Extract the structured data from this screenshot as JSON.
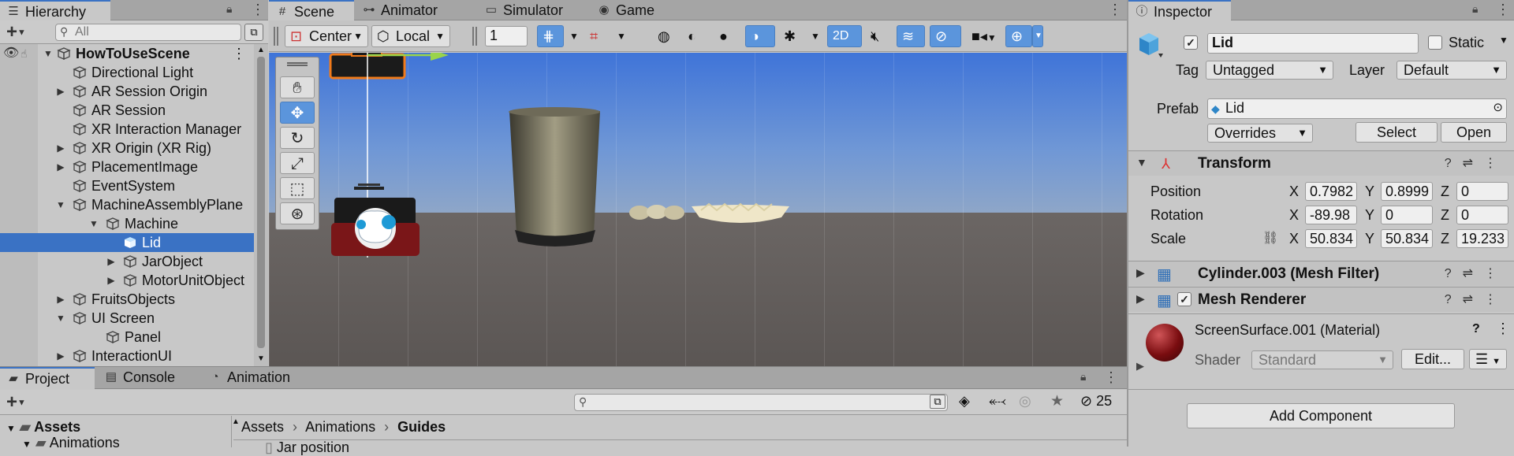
{
  "hierarchy": {
    "tab_label": "Hierarchy",
    "search_placeholder": "All",
    "add_label": "+",
    "items": [
      {
        "label": "HowToUseScene",
        "depth": 0,
        "expand": "down",
        "bold": true,
        "selected": false
      },
      {
        "label": "Directional Light",
        "depth": 1,
        "expand": "",
        "bold": false,
        "selected": false
      },
      {
        "label": "AR Session Origin",
        "depth": 1,
        "expand": "right",
        "bold": false,
        "selected": false
      },
      {
        "label": "AR Session",
        "depth": 1,
        "expand": "",
        "bold": false,
        "selected": false
      },
      {
        "label": "XR Interaction Manager",
        "depth": 1,
        "expand": "",
        "bold": false,
        "selected": false
      },
      {
        "label": "XR Origin (XR Rig)",
        "depth": 1,
        "expand": "right",
        "bold": false,
        "selected": false
      },
      {
        "label": "PlacementImage",
        "depth": 1,
        "expand": "right",
        "bold": false,
        "selected": false
      },
      {
        "label": "EventSystem",
        "depth": 1,
        "expand": "",
        "bold": false,
        "selected": false
      },
      {
        "label": "MachineAssemblyPlane",
        "depth": 1,
        "expand": "down",
        "bold": false,
        "selected": false
      },
      {
        "label": "Machine",
        "depth": 2,
        "expand": "down",
        "bold": false,
        "selected": false
      },
      {
        "label": "Lid",
        "depth": 3,
        "expand": "",
        "bold": false,
        "selected": true
      },
      {
        "label": "JarObject",
        "depth": 3,
        "expand": "right",
        "bold": false,
        "selected": false
      },
      {
        "label": "MotorUnitObject",
        "depth": 3,
        "expand": "right",
        "bold": false,
        "selected": false
      },
      {
        "label": "FruitsObjects",
        "depth": 1,
        "expand": "right",
        "bold": false,
        "selected": false
      },
      {
        "label": "UI Screen",
        "depth": 1,
        "expand": "down",
        "bold": false,
        "selected": false
      },
      {
        "label": "Panel",
        "depth": 2,
        "expand": "",
        "bold": false,
        "selected": false
      },
      {
        "label": "InteractionUI",
        "depth": 1,
        "expand": "right",
        "bold": false,
        "selected": false
      }
    ]
  },
  "scene_tabs": [
    {
      "label": "Scene",
      "icon": "grid-icon"
    },
    {
      "label": "Animator",
      "icon": "animator-icon"
    },
    {
      "label": "Simulator",
      "icon": "simulator-icon"
    },
    {
      "label": "Game",
      "icon": "gamepad-icon"
    }
  ],
  "scene_toolbar": {
    "pivot_label": "Center",
    "space_label": "Local",
    "grid_value": "1",
    "mode_2d_label": "2D"
  },
  "inspector": {
    "tab_label": "Inspector",
    "object_name": "Lid",
    "active_checked": true,
    "static_label": "Static",
    "tag_label": "Tag",
    "tag_value": "Untagged",
    "layer_label": "Layer",
    "layer_value": "Default",
    "prefab_label": "Prefab",
    "prefab_value": "Lid",
    "overrides_label": "Overrides",
    "select_label": "Select",
    "open_label": "Open",
    "transform": {
      "title": "Transform",
      "position_label": "Position",
      "rotation_label": "Rotation",
      "scale_label": "Scale",
      "position": {
        "x": "0.7982",
        "y": "0.8999",
        "z": "0"
      },
      "rotation": {
        "x": "-89.98",
        "y": "0",
        "z": "0"
      },
      "scale": {
        "x": "50.834",
        "y": "50.834",
        "z": "19.233"
      }
    },
    "mesh_filter_title": "Cylinder.003 (Mesh Filter)",
    "mesh_renderer_title": "Mesh Renderer",
    "material": {
      "name": "ScreenSurface.001 (Material)",
      "shader_label": "Shader",
      "shader_value": "Standard",
      "edit_label": "Edit...",
      "color": "#7a0d10"
    },
    "add_component_label": "Add Component"
  },
  "bottom": {
    "tabs": [
      {
        "label": "Project",
        "icon": "folder-icon"
      },
      {
        "label": "Console",
        "icon": "console-icon"
      },
      {
        "label": "Animation",
        "icon": "animation-icon"
      }
    ],
    "hidden_count": "25",
    "tree": [
      {
        "label": "Assets",
        "bold": true
      },
      {
        "label": "Animations",
        "bold": false
      }
    ],
    "breadcrumb": [
      "Assets",
      "Animations",
      "Guides"
    ],
    "file_partial": "Jar position"
  },
  "colors": {
    "selection": "#3a72c4",
    "accent_button": "#5b95dc"
  }
}
